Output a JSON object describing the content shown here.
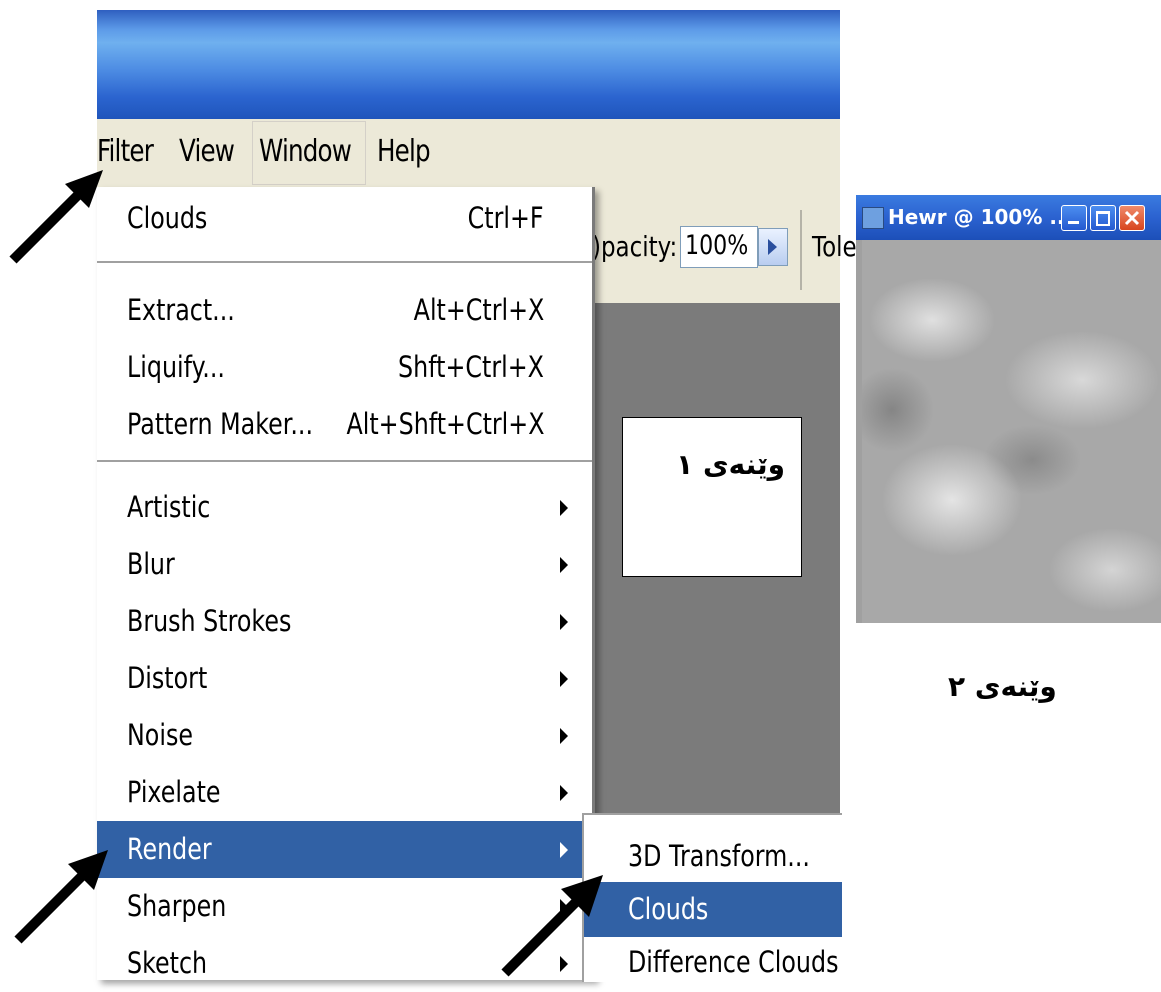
{
  "menubar": {
    "items": [
      "Filter",
      "View",
      "Window",
      "Help"
    ]
  },
  "filter_menu": {
    "groups": [
      [
        {
          "label": "Clouds",
          "shortcut": "Ctrl+F"
        }
      ],
      [
        {
          "label": "Extract...",
          "shortcut": "Alt+Ctrl+X"
        },
        {
          "label": "Liquify...",
          "shortcut": "Shft+Ctrl+X"
        },
        {
          "label": "Pattern Maker...",
          "shortcut": "Alt+Shft+Ctrl+X"
        }
      ],
      [
        {
          "label": "Artistic"
        },
        {
          "label": "Blur"
        },
        {
          "label": "Brush Strokes"
        },
        {
          "label": "Distort"
        },
        {
          "label": "Noise"
        },
        {
          "label": "Pixelate"
        },
        {
          "label": "Render"
        },
        {
          "label": "Sharpen"
        },
        {
          "label": "Sketch"
        }
      ]
    ],
    "highlighted": "Render"
  },
  "render_submenu": {
    "items": [
      "3D Transform...",
      "Clouds",
      "Difference Clouds"
    ],
    "highlighted": "Clouds"
  },
  "toolbar": {
    "opacity_label": ")pacity:",
    "opacity_value": "100%",
    "tolerance_label": "Tole"
  },
  "captions": {
    "figure1": "وێنەی ١",
    "figure2": "وێنەی ٢"
  },
  "doc_window": {
    "title": "Hewr @ 100% ..."
  },
  "colors": {
    "menu_highlight": "#3161a5",
    "canvas_gray": "#7b7b7b"
  }
}
